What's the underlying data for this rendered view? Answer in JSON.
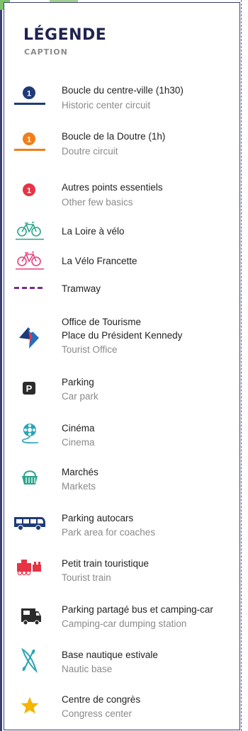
{
  "header": {
    "title": "Légende",
    "subtitle": "Caption"
  },
  "items": [
    {
      "icon": "circle-badge-navy-1",
      "badge": "1",
      "color": "#1f3a7a",
      "label": "Boucle du centre-ville (1h30)",
      "sub": "Historic center circuit"
    },
    {
      "icon": "circle-badge-orange-1",
      "badge": "1",
      "color": "#f07e1b",
      "label": "Boucle de la Doutre (1h)",
      "sub": "Doutre circuit"
    },
    {
      "icon": "circle-badge-red-1",
      "badge": "1",
      "color": "#e63346",
      "label": "Autres points essentiels",
      "sub": "Other few basics"
    },
    {
      "icon": "bicycle-teal-icon",
      "color": "#2aa58c",
      "label": "La Loire à vélo",
      "sub": ""
    },
    {
      "icon": "bicycle-pink-icon",
      "color": "#e8417e",
      "label": "La Vélo Francette",
      "sub": ""
    },
    {
      "icon": "tramway-dashed-line",
      "color": "#7a2d8a",
      "label": "Tramway",
      "sub": ""
    },
    {
      "icon": "tourist-office-logo-icon",
      "label": "Office de Tourisme",
      "label2": "Place du Président Kennedy",
      "sub": "Tourist Office"
    },
    {
      "icon": "parking-p-icon",
      "badge": "P",
      "label": "Parking",
      "sub": "Car park"
    },
    {
      "icon": "film-reel-icon",
      "color": "#2aa5b8",
      "label": "Cinéma",
      "sub": "Cinema"
    },
    {
      "icon": "market-basket-icon",
      "color": "#2aa58c",
      "label": "Marchés",
      "sub": "Markets"
    },
    {
      "icon": "coach-bus-icon",
      "color": "#1f3a7a",
      "label": "Parking autocars",
      "sub": "Park area for coaches"
    },
    {
      "icon": "tourist-train-icon",
      "color": "#e63346",
      "label": "Petit train touristique",
      "sub": "Tourist train"
    },
    {
      "icon": "camper-van-icon",
      "color": "#2b2b2b",
      "label": "Parking partagé bus et camping-car",
      "sub": "Camping-car dumping station"
    },
    {
      "icon": "canoe-paddle-icon",
      "color": "#2aa5b8",
      "label": "Base nautique estivale",
      "sub": "Nautic base"
    },
    {
      "icon": "star-icon",
      "color": "#f5b400",
      "label": "Centre de congrès",
      "sub": "Congress center"
    }
  ]
}
